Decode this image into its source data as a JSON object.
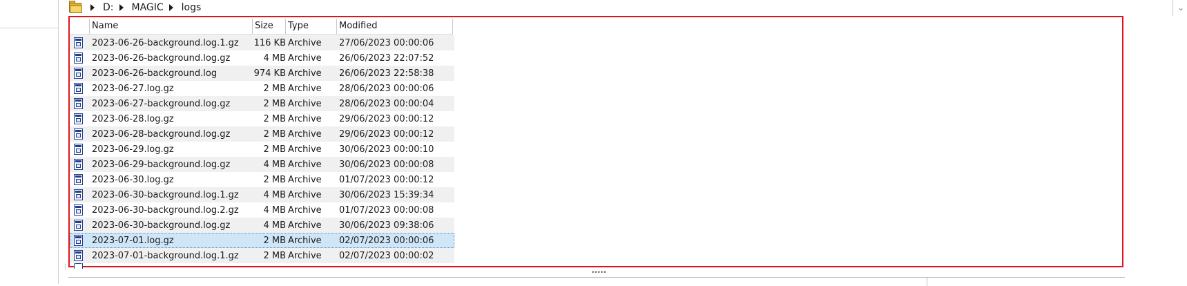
{
  "breadcrumb": {
    "items": [
      "D:",
      "MAGIC",
      "logs"
    ]
  },
  "columns": {
    "name": "Name",
    "size": "Size",
    "type": "Type",
    "modified": "Modified"
  },
  "files": [
    {
      "name": "2023-06-26-background.log.1.gz",
      "size": "116 KB",
      "type": "Archive",
      "modified": "27/06/2023 00:00:06"
    },
    {
      "name": "2023-06-26-background.log.gz",
      "size": "4 MB",
      "type": "Archive",
      "modified": "26/06/2023 22:07:52"
    },
    {
      "name": "2023-06-26-background.log",
      "size": "974 KB",
      "type": "Archive",
      "modified": "26/06/2023 22:58:38"
    },
    {
      "name": "2023-06-27.log.gz",
      "size": "2 MB",
      "type": "Archive",
      "modified": "28/06/2023 00:00:06"
    },
    {
      "name": "2023-06-27-background.log.gz",
      "size": "2 MB",
      "type": "Archive",
      "modified": "28/06/2023 00:00:04"
    },
    {
      "name": "2023-06-28.log.gz",
      "size": "2 MB",
      "type": "Archive",
      "modified": "29/06/2023 00:00:12"
    },
    {
      "name": "2023-06-28-background.log.gz",
      "size": "2 MB",
      "type": "Archive",
      "modified": "29/06/2023 00:00:12"
    },
    {
      "name": "2023-06-29.log.gz",
      "size": "2 MB",
      "type": "Archive",
      "modified": "30/06/2023 00:00:10"
    },
    {
      "name": "2023-06-29-background.log.gz",
      "size": "4 MB",
      "type": "Archive",
      "modified": "30/06/2023 00:00:08"
    },
    {
      "name": "2023-06-30.log.gz",
      "size": "2 MB",
      "type": "Archive",
      "modified": "01/07/2023 00:00:12"
    },
    {
      "name": "2023-06-30-background.log.1.gz",
      "size": "4 MB",
      "type": "Archive",
      "modified": "30/06/2023 15:39:34"
    },
    {
      "name": "2023-06-30-background.log.2.gz",
      "size": "4 MB",
      "type": "Archive",
      "modified": "01/07/2023 00:00:08"
    },
    {
      "name": "2023-06-30-background.log.gz",
      "size": "4 MB",
      "type": "Archive",
      "modified": "30/06/2023 09:38:06"
    },
    {
      "name": "2023-07-01.log.gz",
      "size": "2 MB",
      "type": "Archive",
      "modified": "02/07/2023 00:00:06"
    },
    {
      "name": "2023-07-01-background.log.1.gz",
      "size": "2 MB",
      "type": "Archive",
      "modified": "02/07/2023 00:00:02"
    }
  ],
  "selected_index": 13,
  "icons": {
    "path_folder": "folder-icon",
    "file": "archive-file-icon",
    "path_dropdown": "chevron-down-icon"
  },
  "colors": {
    "highlight_border": "#e0141e",
    "selection": "#cfe6f8",
    "alt_row": "#f0f0f0"
  }
}
